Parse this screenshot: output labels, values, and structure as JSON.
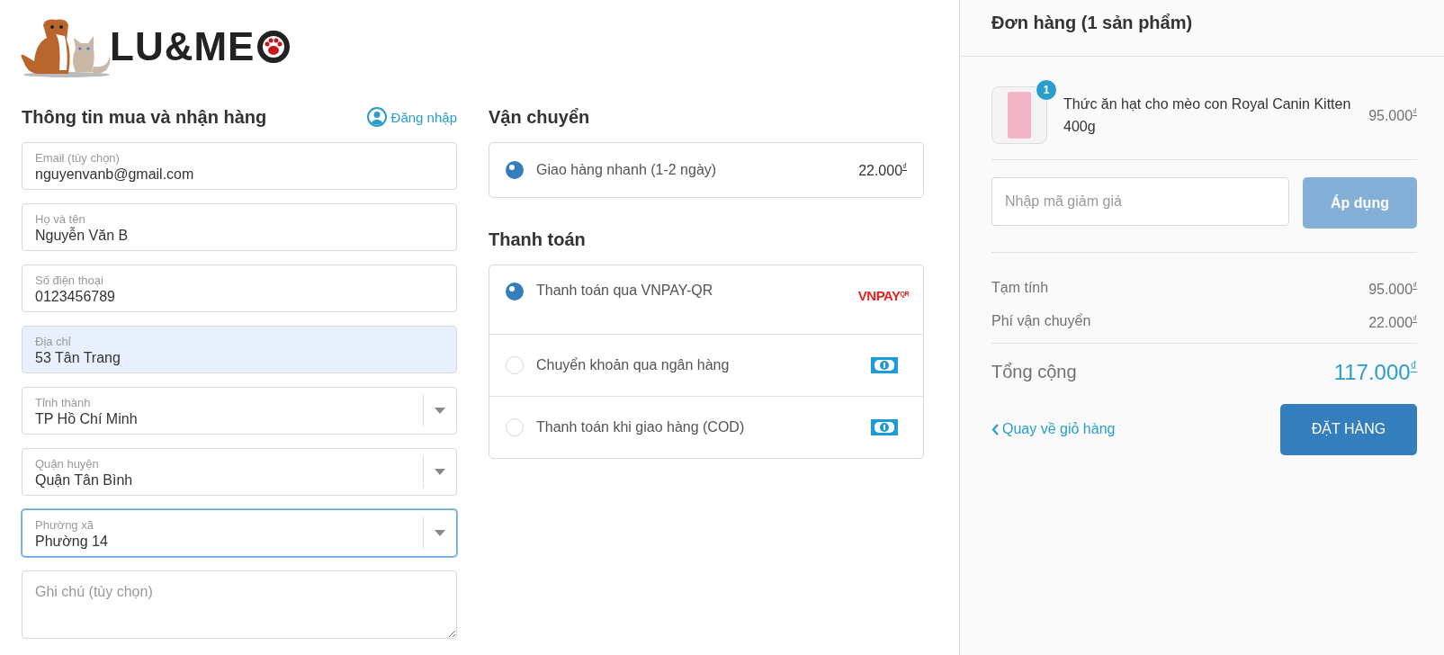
{
  "brand": {
    "name": "LU&ME"
  },
  "buyer": {
    "title": "Thông tin mua và nhận hàng",
    "login": "Đăng nhập",
    "fields": [
      {
        "kind": "text",
        "label": "Email (tùy chọn)",
        "value": "nguyenvanb@gmail.com",
        "autofilled": false,
        "focused": false
      },
      {
        "kind": "text",
        "label": "Họ và tên",
        "value": "Nguyễn Văn B",
        "autofilled": false,
        "focused": false
      },
      {
        "kind": "text",
        "label": "Số điện thoại",
        "value": "0123456789",
        "autofilled": false,
        "focused": false
      },
      {
        "kind": "text",
        "label": "Địa chỉ",
        "value": "53 Tân Trang",
        "autofilled": true,
        "focused": false
      },
      {
        "kind": "select",
        "label": "Tỉnh thành",
        "value": "TP Hồ Chí Minh",
        "autofilled": false,
        "focused": false
      },
      {
        "kind": "select",
        "label": "Quận huyện",
        "value": "Quận Tân Bình",
        "autofilled": false,
        "focused": false
      },
      {
        "kind": "select",
        "label": "Phường xã",
        "value": "Phường 14",
        "autofilled": false,
        "focused": true
      }
    ],
    "note": {
      "placeholder": "Ghi chú (tùy chọn)"
    }
  },
  "shipping": {
    "title": "Vận chuyển",
    "options": [
      {
        "label": "Giao hàng nhanh (1-2 ngày)",
        "price": "22.000$^{₫}$",
        "selected": true
      }
    ]
  },
  "payment": {
    "title": "Thanh toán",
    "options": [
      {
        "label": "Thanh toán qua VNPAY-QR",
        "selected": true,
        "kind": "logo",
        "logo": "VNPAY",
        "logo_sup": "QR"
      },
      {
        "label": "Chuyển khoản qua ngân hàng",
        "selected": false,
        "kind": "banknote"
      },
      {
        "label": "Thanh toán khi giao hàng (COD)",
        "selected": false,
        "kind": "banknote"
      }
    ]
  },
  "order": {
    "title": "Đơn hàng (1 sản phẩm)",
    "items": [
      {
        "name": "Thức ăn hạt cho mèo con Royal Canin Kitten 400g",
        "quantity": "1",
        "price": "95.000$^{₫}$"
      }
    ],
    "coupon": {
      "placeholder": "Nhập mã giảm giá",
      "button": "Áp dụng"
    },
    "lines": [
      {
        "label": "Tạm tính",
        "value": "95.000$^{₫}$"
      },
      {
        "label": "Phí vận chuyển",
        "value": "22.000$^{₫}$"
      }
    ],
    "total": {
      "label": "Tổng cộng",
      "value": "117.000$^{₫}$"
    },
    "back_link": "Quay về giỏ hàng",
    "submit": "ĐẶT HÀNG"
  }
}
